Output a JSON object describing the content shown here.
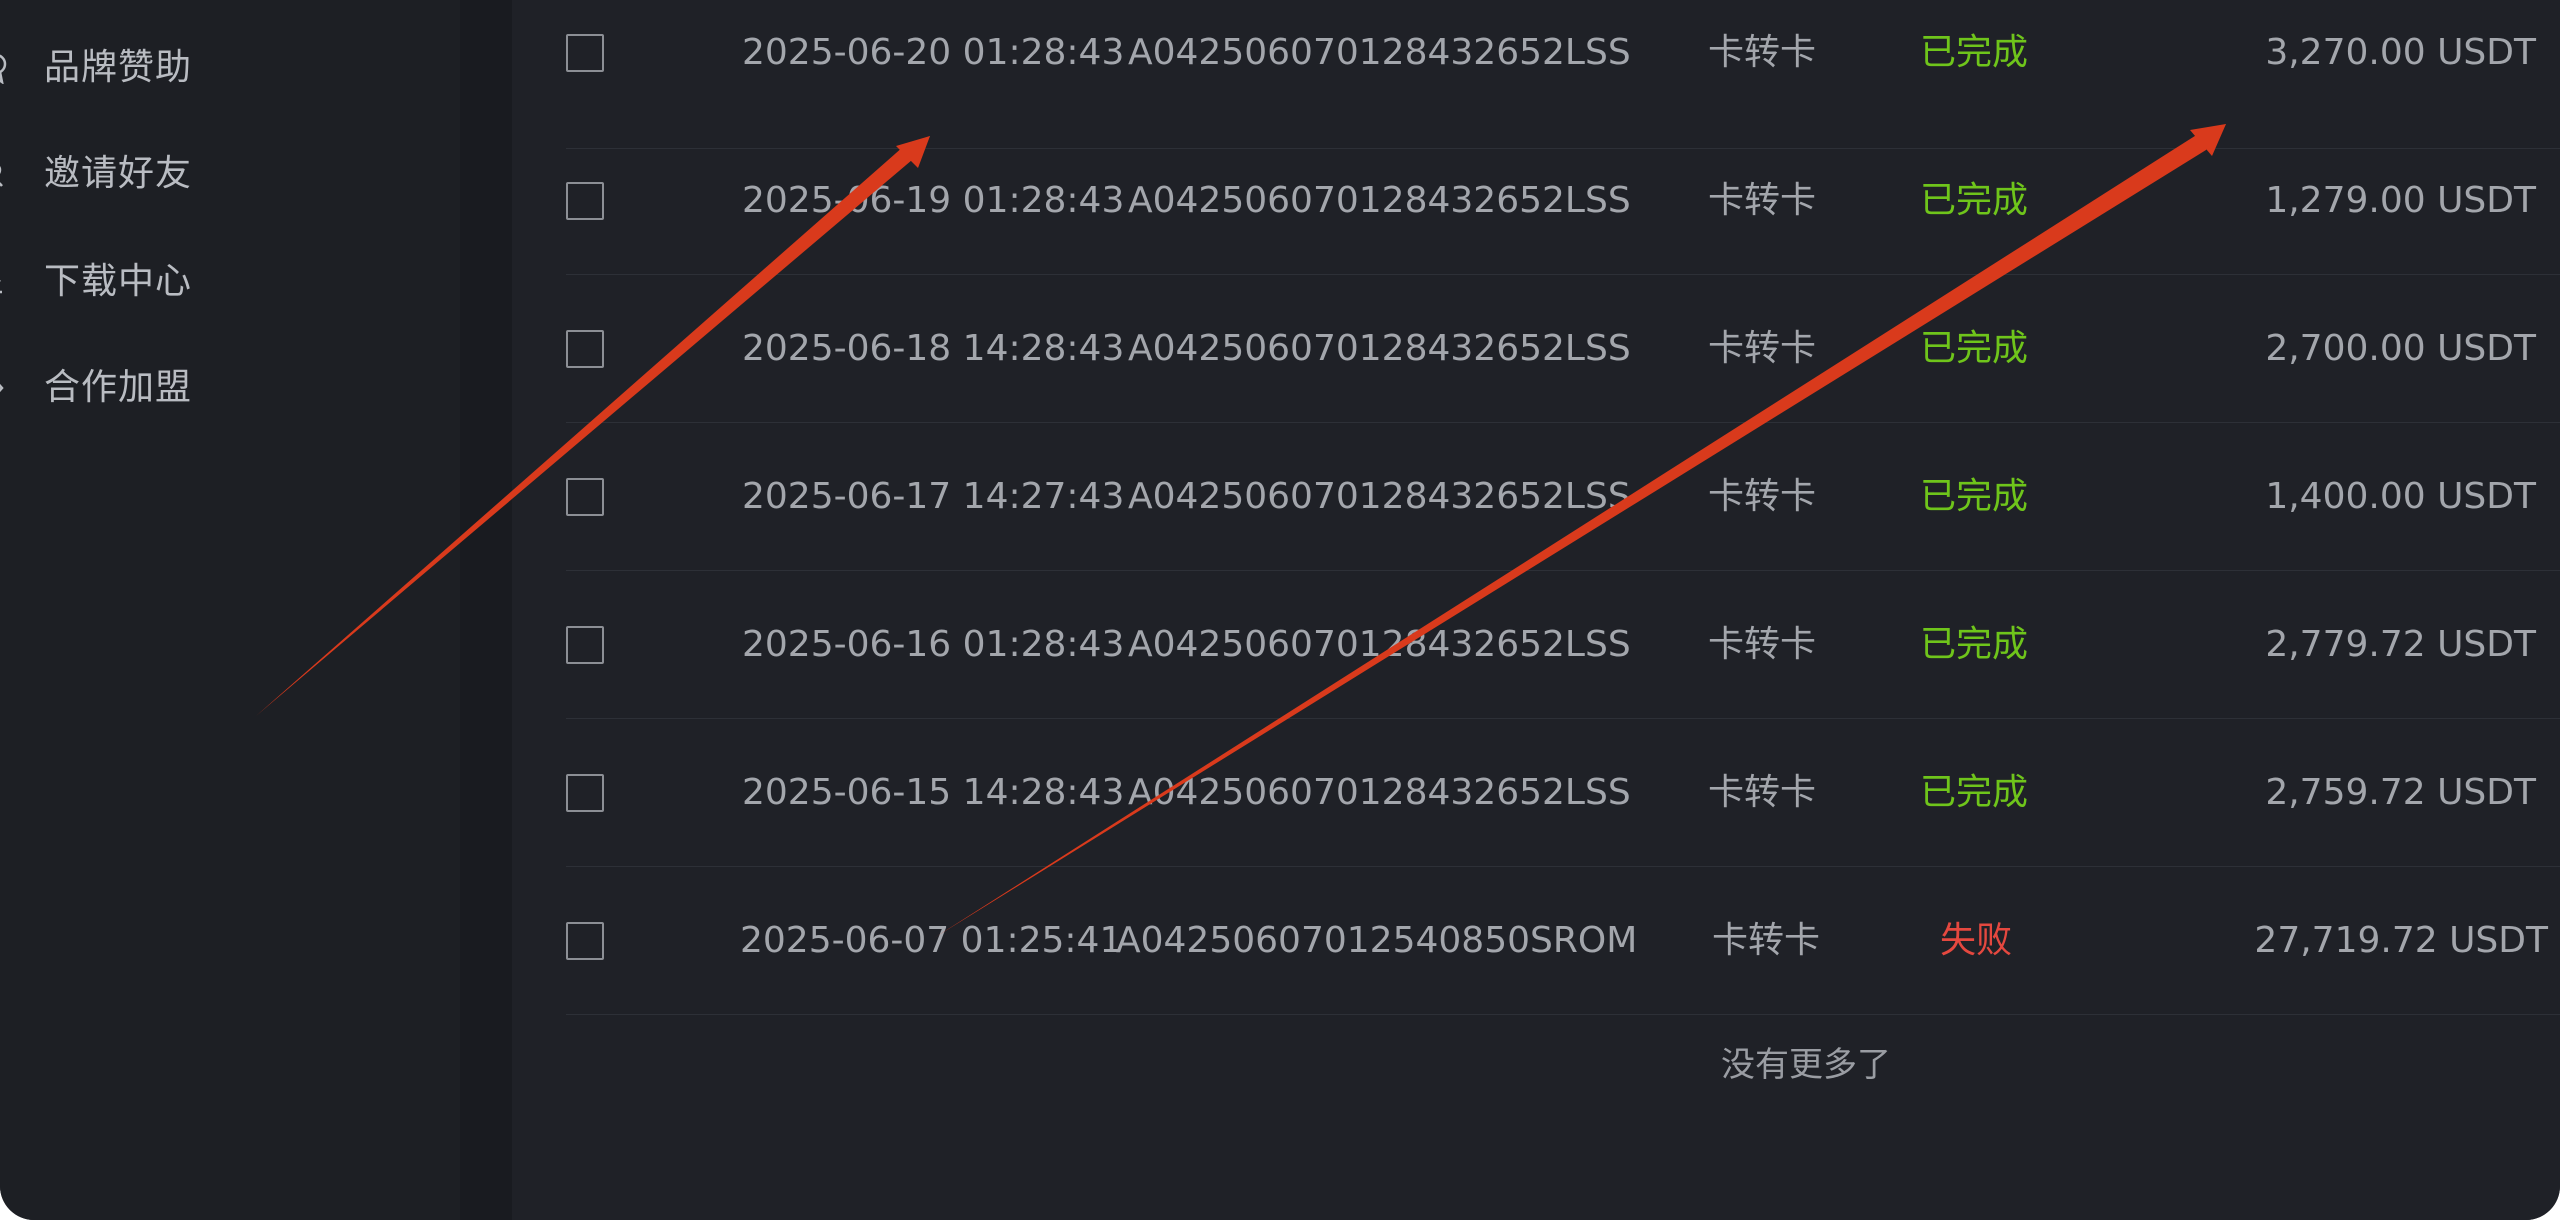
{
  "sidebar": {
    "items": [
      {
        "label": "品牌赞助",
        "icon": "medal-icon"
      },
      {
        "label": "邀请好友",
        "icon": "user-icon"
      },
      {
        "label": "下载中心",
        "icon": "download-icon"
      },
      {
        "label": "合作加盟",
        "icon": "handshake-icon"
      }
    ]
  },
  "transactions": {
    "rows": [
      {
        "time": "2025-06-20 01:28:43",
        "order_id": "A04250607012843 2652LSS",
        "type": "卡转卡",
        "status": "已完成",
        "amount": "3,270.00 USDT"
      },
      {
        "time": "2025-06-19 01:28:43",
        "order_id": "A042506070128432652LSS",
        "type": "卡转卡",
        "status": "已完成",
        "amount": "1,279.00 USDT"
      },
      {
        "time": "2025-06-18 14:28:43",
        "order_id": "A042506070128432652LSS",
        "type": "卡转卡",
        "status": "已完成",
        "amount": "2,700.00 USDT"
      },
      {
        "time": "2025-06-17 14:27:43",
        "order_id": "A042506070128432652LSS",
        "type": "卡转卡",
        "status": "已完成",
        "amount": "1,400.00 USDT"
      },
      {
        "time": "2025-06-16 01:28:43",
        "order_id": "A042506070128432652LSS",
        "type": "卡转卡",
        "status": "已完成",
        "amount": "2,779.72 USDT"
      },
      {
        "time": "2025-06-15 14:28:43",
        "order_id": "A042506070128432652LSS",
        "type": "卡转卡",
        "status": "已完成",
        "amount": "2,759.72 USDT"
      },
      {
        "time": "2025-06-07 01:25:41",
        "order_id": "A04250607012540850SROM",
        "type": "卡转卡",
        "status": "失败",
        "amount": "27,719.72 USDT"
      }
    ],
    "footer": "没有更多了"
  },
  "colors": {
    "status_success": "#6fc51b",
    "status_failed": "#e5483f",
    "annotation_arrow": "#d93a1c"
  }
}
